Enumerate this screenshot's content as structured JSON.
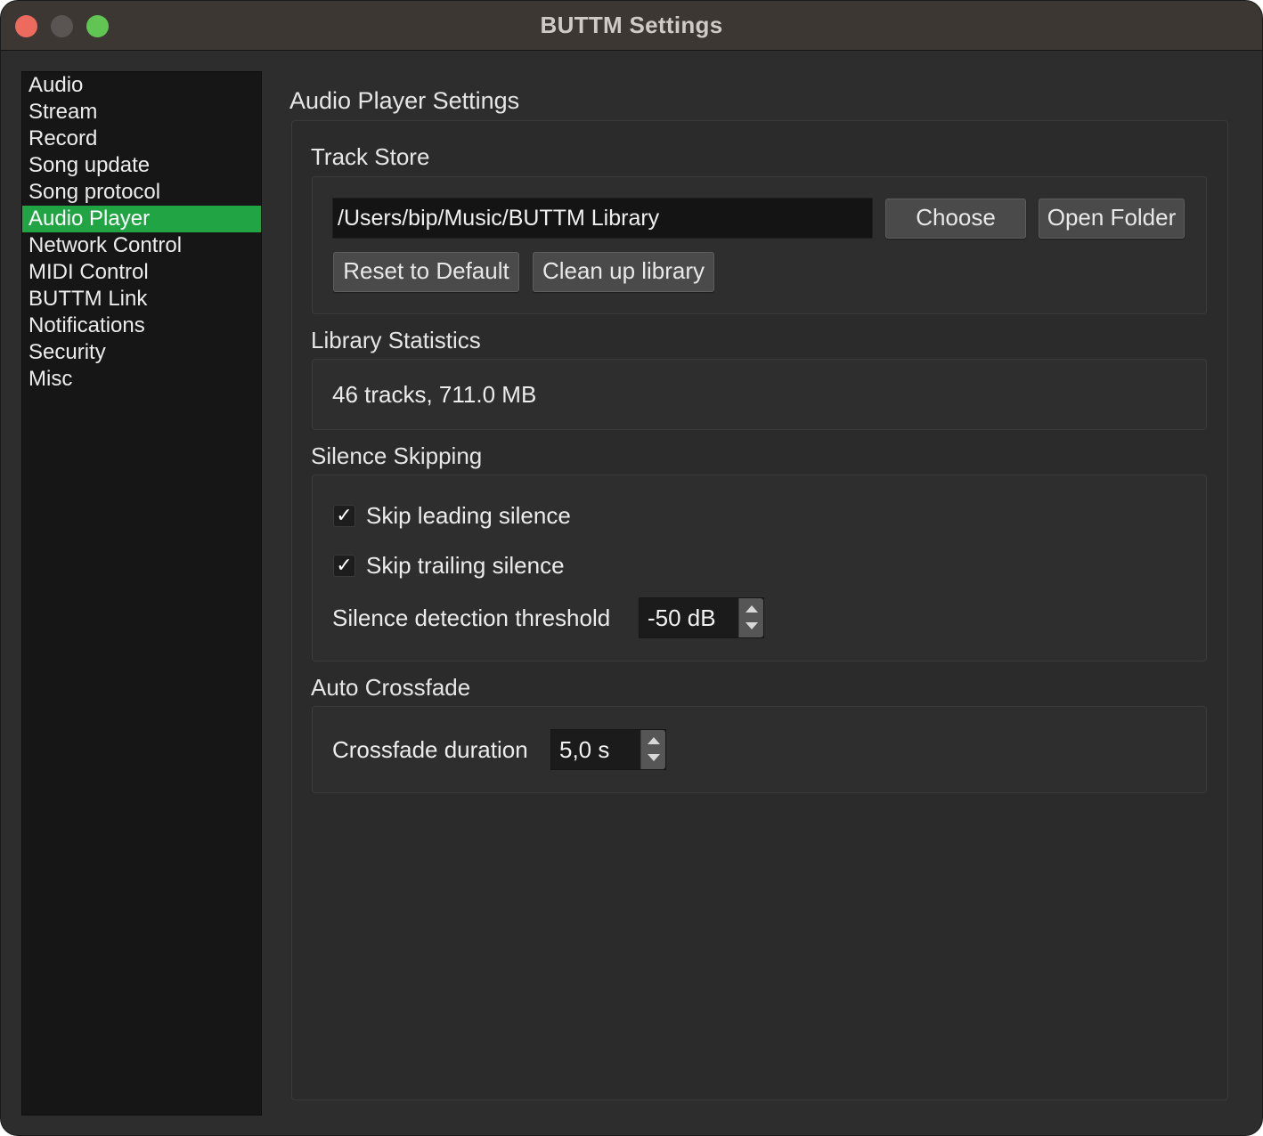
{
  "window": {
    "title": "BUTTM Settings"
  },
  "sidebar": {
    "items": [
      {
        "label": "Audio"
      },
      {
        "label": "Stream"
      },
      {
        "label": "Record"
      },
      {
        "label": "Song update"
      },
      {
        "label": "Song protocol"
      },
      {
        "label": "Audio Player",
        "active": true
      },
      {
        "label": "Network Control"
      },
      {
        "label": "MIDI Control"
      },
      {
        "label": "BUTTM Link"
      },
      {
        "label": "Notifications"
      },
      {
        "label": "Security"
      },
      {
        "label": "Misc"
      }
    ],
    "active_color": "#21a544"
  },
  "main": {
    "heading": "Audio Player Settings",
    "track_store": {
      "title": "Track Store",
      "path_value": "/Users/bip/Music/BUTTM Library",
      "choose_label": "Choose",
      "open_folder_label": "Open Folder",
      "reset_label": "Reset to Default",
      "cleanup_label": "Clean up library"
    },
    "library_statistics": {
      "title": "Library Statistics",
      "summary": "46 tracks, 711.0 MB"
    },
    "silence_skipping": {
      "title": "Silence Skipping",
      "skip_leading_label": "Skip leading silence",
      "skip_leading_checked": true,
      "skip_trailing_label": "Skip trailing silence",
      "skip_trailing_checked": true,
      "threshold_label": "Silence detection threshold",
      "threshold_value": "-50 dB"
    },
    "auto_crossfade": {
      "title": "Auto Crossfade",
      "duration_label": "Crossfade duration",
      "duration_value": "5,0 s"
    }
  },
  "icons": {
    "check_glyph": "✓"
  }
}
